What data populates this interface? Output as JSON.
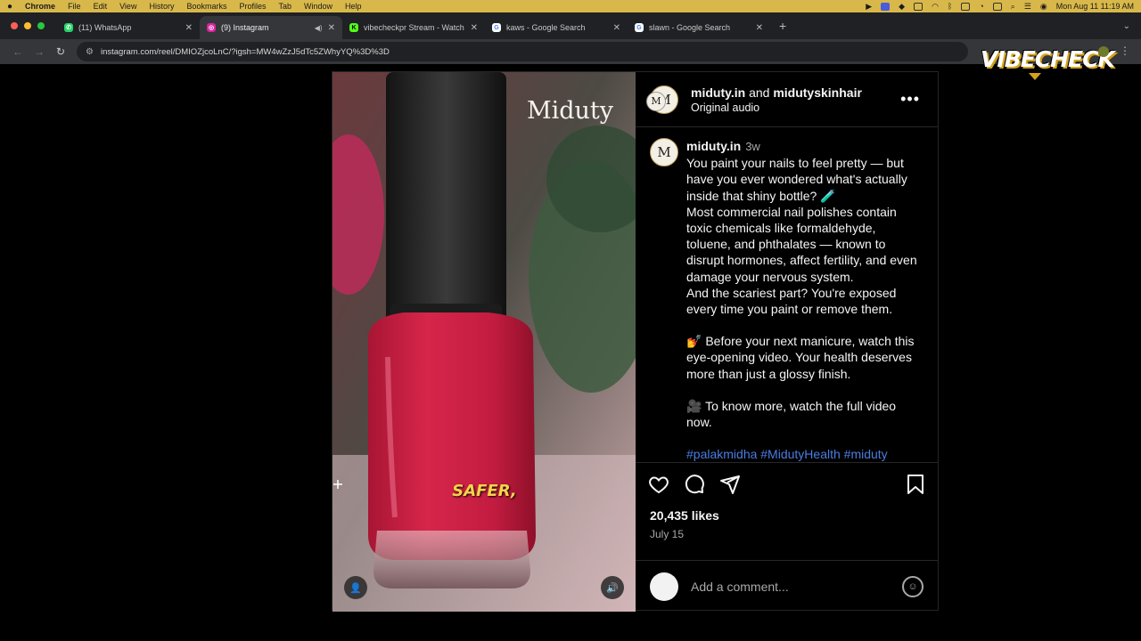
{
  "menubar": {
    "app": "Chrome",
    "items": [
      "File",
      "Edit",
      "View",
      "History",
      "Bookmarks",
      "Profiles",
      "Tab",
      "Window",
      "Help"
    ],
    "clock": "Mon Aug 11  11:19 AM"
  },
  "tabs": [
    {
      "title": "(11) WhatsApp",
      "icon": "whatsapp-icon",
      "color": "#25d366"
    },
    {
      "title": "(9) Instagram",
      "icon": "instagram-icon",
      "color": "#d6249f"
    },
    {
      "title": "vibecheckpr Stream - Watch",
      "icon": "kick-icon",
      "color": "#53fc18"
    },
    {
      "title": "kaws - Google Search",
      "icon": "google-icon",
      "color": "#4285f4"
    },
    {
      "title": "slawn - Google Search",
      "icon": "google-icon",
      "color": "#4285f4"
    }
  ],
  "address": {
    "url": "instagram.com/reel/DMIOZjcoLnC/?igsh=MW4wZzJ5dTc5ZWhyYQ%3D%3D"
  },
  "overlay_logo": "VIBECHECK",
  "video": {
    "brand": "Miduty",
    "caption": "SAFER,"
  },
  "header": {
    "user1": "miduty.in",
    "and_word": "and",
    "user2": "midutyskinhair",
    "audio": "Original audio"
  },
  "post": {
    "username": "miduty.in",
    "time": "3w",
    "para1": "You paint your nails to feel pretty — but have you ever wondered what's actually inside that shiny bottle? 🧪",
    "para2": "Most commercial nail polishes contain toxic chemicals like formaldehyde, toluene, and phthalates — known to disrupt hormones, affect fertility, and even damage your nervous system.",
    "para3": "And the scariest part? You're exposed every time you paint or remove them.",
    "para4": "💅 Before your next manicure, watch this eye-opening video. Your health deserves more than just a glossy finish.",
    "para5": "🎥 To know more, watch the full video now.",
    "tags": "#palakmidha #MidutyHealth #miduty #supplements #nailpolish"
  },
  "stats": {
    "likes": "20,435 likes",
    "date": "July 15"
  },
  "comment": {
    "placeholder": "Add a comment..."
  }
}
